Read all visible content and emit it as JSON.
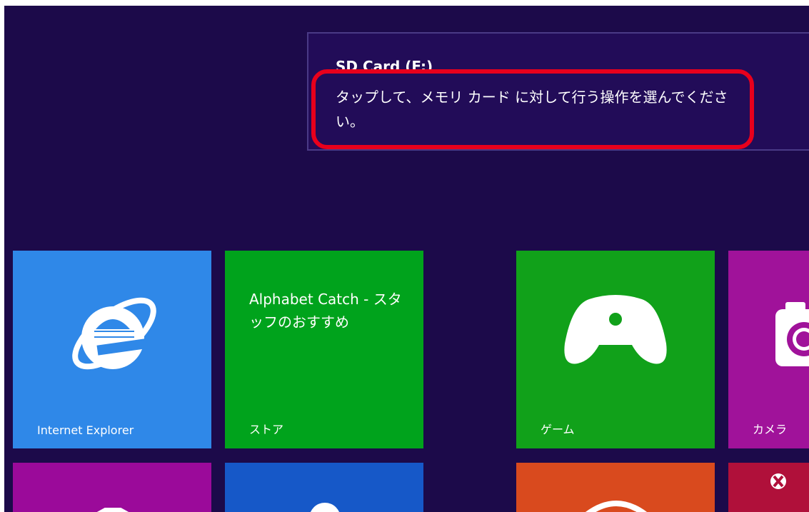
{
  "notification": {
    "title": "SD Card (F:)",
    "message": "タップして、メモリ カード に対して行う操作を選んでください。"
  },
  "tiles": {
    "internet_explorer": {
      "label": "Internet Explorer",
      "icon": "internet-explorer-icon"
    },
    "store": {
      "title": "Alphabet Catch - スタッフのおすすめ",
      "label": "ストア"
    },
    "games": {
      "label": "ゲーム",
      "icon": "gamepad-icon"
    },
    "camera": {
      "label": "カメラ",
      "icon": "camera-icon"
    }
  },
  "colors": {
    "background": "#1c0a4a",
    "highlight": "#e8001c",
    "ie_tile": "#2f88e8",
    "store_tile": "#00a31c",
    "game_tile": "#11a11a",
    "camera_tile": "#a0129a"
  }
}
